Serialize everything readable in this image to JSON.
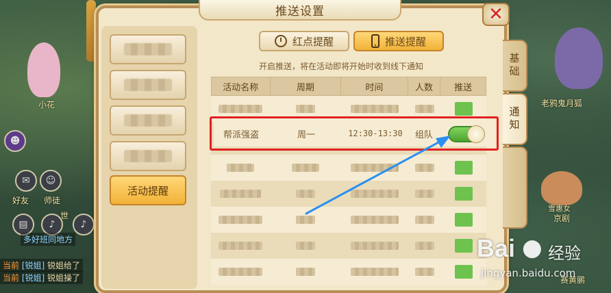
{
  "window": {
    "title": "推送设置"
  },
  "left_menu": {
    "items": [
      {
        "label": "",
        "blurred": true
      },
      {
        "label": "",
        "blurred": true
      },
      {
        "label": "",
        "blurred": true
      },
      {
        "label": "",
        "blurred": true
      },
      {
        "label": "活动提醒",
        "active": true
      }
    ]
  },
  "top_tabs": [
    {
      "label": "红点提醒",
      "icon": "alarm-clock-icon",
      "active": false
    },
    {
      "label": "推送提醒",
      "icon": "phone-icon",
      "active": true
    }
  ],
  "hint": "开启推送，将在活动即将开始时收到线下通知",
  "table": {
    "headers": [
      "活动名称",
      "周期",
      "时间",
      "人数",
      "推送"
    ],
    "highlight_row": {
      "name": "帮派强盗",
      "cycle": "周一",
      "time": "12:30-13:30",
      "people": "组队",
      "push_on": true
    }
  },
  "side_tabs": [
    {
      "label": "基础",
      "active": false
    },
    {
      "label": "通知",
      "active": true
    }
  ],
  "game": {
    "npc_labels": [
      "小花",
      "好友",
      "师徒",
      "世",
      "老鸦鬼月狐",
      "雪惠女",
      "京剧",
      "赛黄鹂"
    ],
    "chat": [
      {
        "tag": "当前",
        "name": "[锐姐]",
        "text": "锐姐给了"
      },
      {
        "tag": "当前",
        "name": "[锐姐]",
        "text": "锐姐操了"
      }
    ],
    "chat_snippet": "多好班同地方"
  },
  "watermark": {
    "brand": "Bai",
    "brand2": "经验",
    "url": "jingyan.baidu.com"
  },
  "colors": {
    "accent": "#f2b237",
    "highlight_border": "#e02020",
    "toggle_on": "#6ec24e",
    "arrow": "#2a8ff0"
  }
}
